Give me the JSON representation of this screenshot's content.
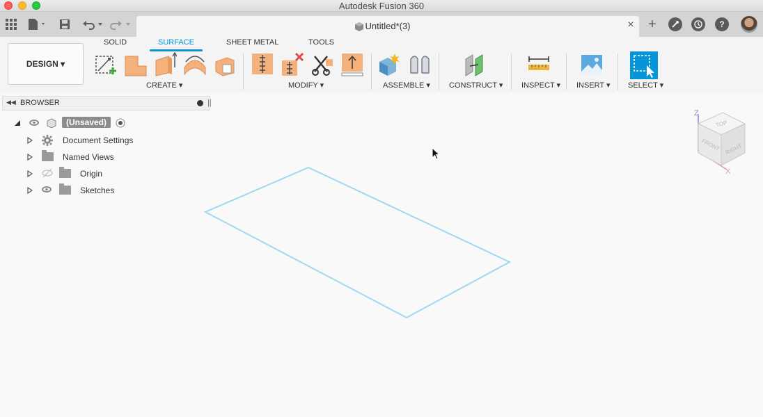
{
  "window": {
    "title": "Autodesk Fusion 360"
  },
  "appbar": {
    "document_title": "Untitled*(3)",
    "close_glyph": "×",
    "new_tab_glyph": "+"
  },
  "ribbon": {
    "workspace": "DESIGN ▾",
    "tabs": [
      {
        "label": "SOLID",
        "active": false
      },
      {
        "label": "SURFACE",
        "active": true
      },
      {
        "label": "SHEET METAL",
        "active": false
      },
      {
        "label": "TOOLS",
        "active": false
      }
    ],
    "groups": [
      {
        "label": "CREATE ▾"
      },
      {
        "label": "MODIFY ▾"
      },
      {
        "label": "ASSEMBLE ▾"
      },
      {
        "label": "CONSTRUCT ▾"
      },
      {
        "label": "INSPECT ▾"
      },
      {
        "label": "INSERT ▾"
      },
      {
        "label": "SELECT ▾"
      }
    ],
    "accent": "#0696d7",
    "tool_color": "#f5b17b"
  },
  "browser": {
    "title": "BROWSER",
    "root": "(Unsaved)",
    "items": [
      {
        "label": "Document Settings"
      },
      {
        "label": "Named Views"
      },
      {
        "label": "Origin"
      },
      {
        "label": "Sketches"
      }
    ]
  },
  "viewcube": {
    "top": "TOP",
    "front": "FRONT",
    "right": "RIGHT",
    "z": "Z",
    "x": "X"
  },
  "sketch_color": "#9fd8f0"
}
